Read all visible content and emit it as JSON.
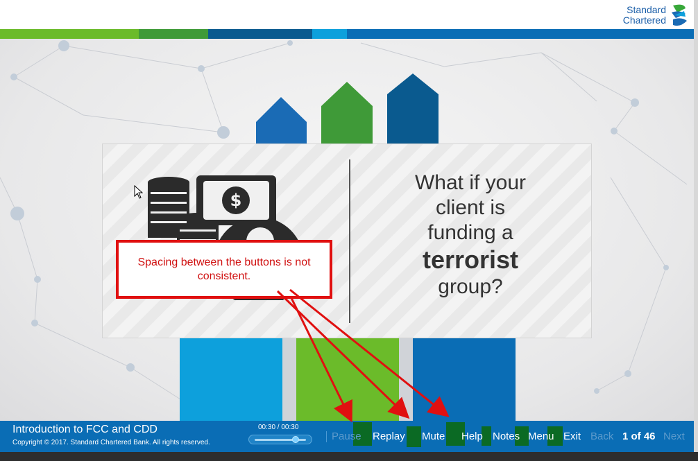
{
  "brand": {
    "line1": "Standard",
    "line2": "Chartered"
  },
  "slide": {
    "question_lines": [
      "What if your",
      "client is",
      "funding a"
    ],
    "question_emphasis": "terrorist",
    "question_end": "group?"
  },
  "annotation": {
    "text": "Spacing between the buttons is not consistent."
  },
  "footer": {
    "course_title": "Introduction to FCC and CDD",
    "copyright": "Copyright © 2017. Standard Chartered Bank. All rights reserved.",
    "time": "00:30 / 00:30",
    "progress": 1.0,
    "buttons": {
      "pause": "Pause",
      "replay": "Replay",
      "mute": "Mute",
      "help": "Help",
      "notes": "Notes",
      "menu": "Menu",
      "exit": "Exit",
      "back": "Back",
      "next": "Next"
    },
    "page_indicator": "1 of 46"
  },
  "colors": {
    "stripe": [
      "#6bbb2a",
      "#3f9a38",
      "#0a5a8f",
      "#0da0dc",
      "#0a6db5"
    ],
    "footer": "#0a6db5",
    "annotation": "#e01010"
  },
  "icons": [
    "standard-chartered-logo-icon",
    "coins-money-icon",
    "mouse-cursor-icon"
  ]
}
